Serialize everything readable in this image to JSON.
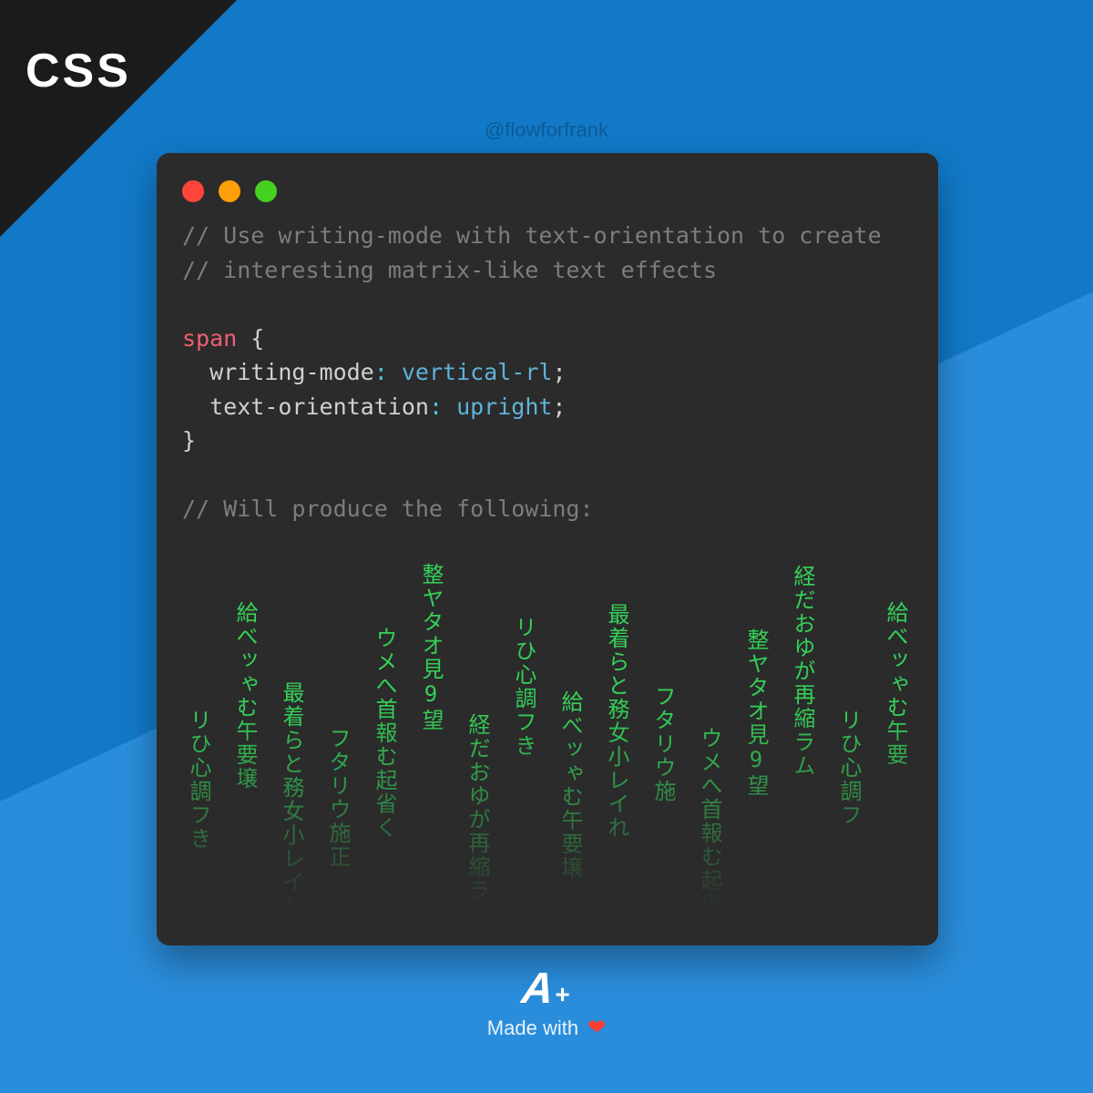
{
  "corner_label": "CSS",
  "handle": "@flowforfrank",
  "code": {
    "comment_line1": "// Use writing-mode with text-orientation to create",
    "comment_line2": "// interesting matrix-like text effects",
    "selector": "span",
    "open_brace": "{",
    "prop1": "writing-mode",
    "val1": "vertical-rl",
    "prop2": "text-orientation",
    "val2": "upright",
    "close_brace": "}",
    "colon": ":",
    "semi": ";",
    "comment_result": "// Will produce the following:"
  },
  "matrix_columns": [
    "リひ心調フき",
    "給べッゃむ午要壌",
    "最着らと務女小レイれ",
    "フタリウ施正",
    "ウメへ首報む起省く",
    "整ヤタオ見9望",
    "経だおゆが再縮ラム",
    "リひ心調フき",
    "給べッゃむ午要壌",
    "最着らと務女小レイれ",
    "フタリウ施",
    "ウメへ首報む起省",
    "整ヤタオ見9望",
    "経だおゆが再縮ラム",
    "リひ心調フ",
    "給べッゃむ午要"
  ],
  "footer": {
    "logo_a": "A",
    "logo_plus": "+",
    "made_with": "Made with",
    "heart": "❤"
  },
  "colors": {
    "bg_light": "#2a8ddb",
    "bg_dark": "#1279c7",
    "card": "#2b2b2b",
    "matrix_green": "#34d058"
  }
}
